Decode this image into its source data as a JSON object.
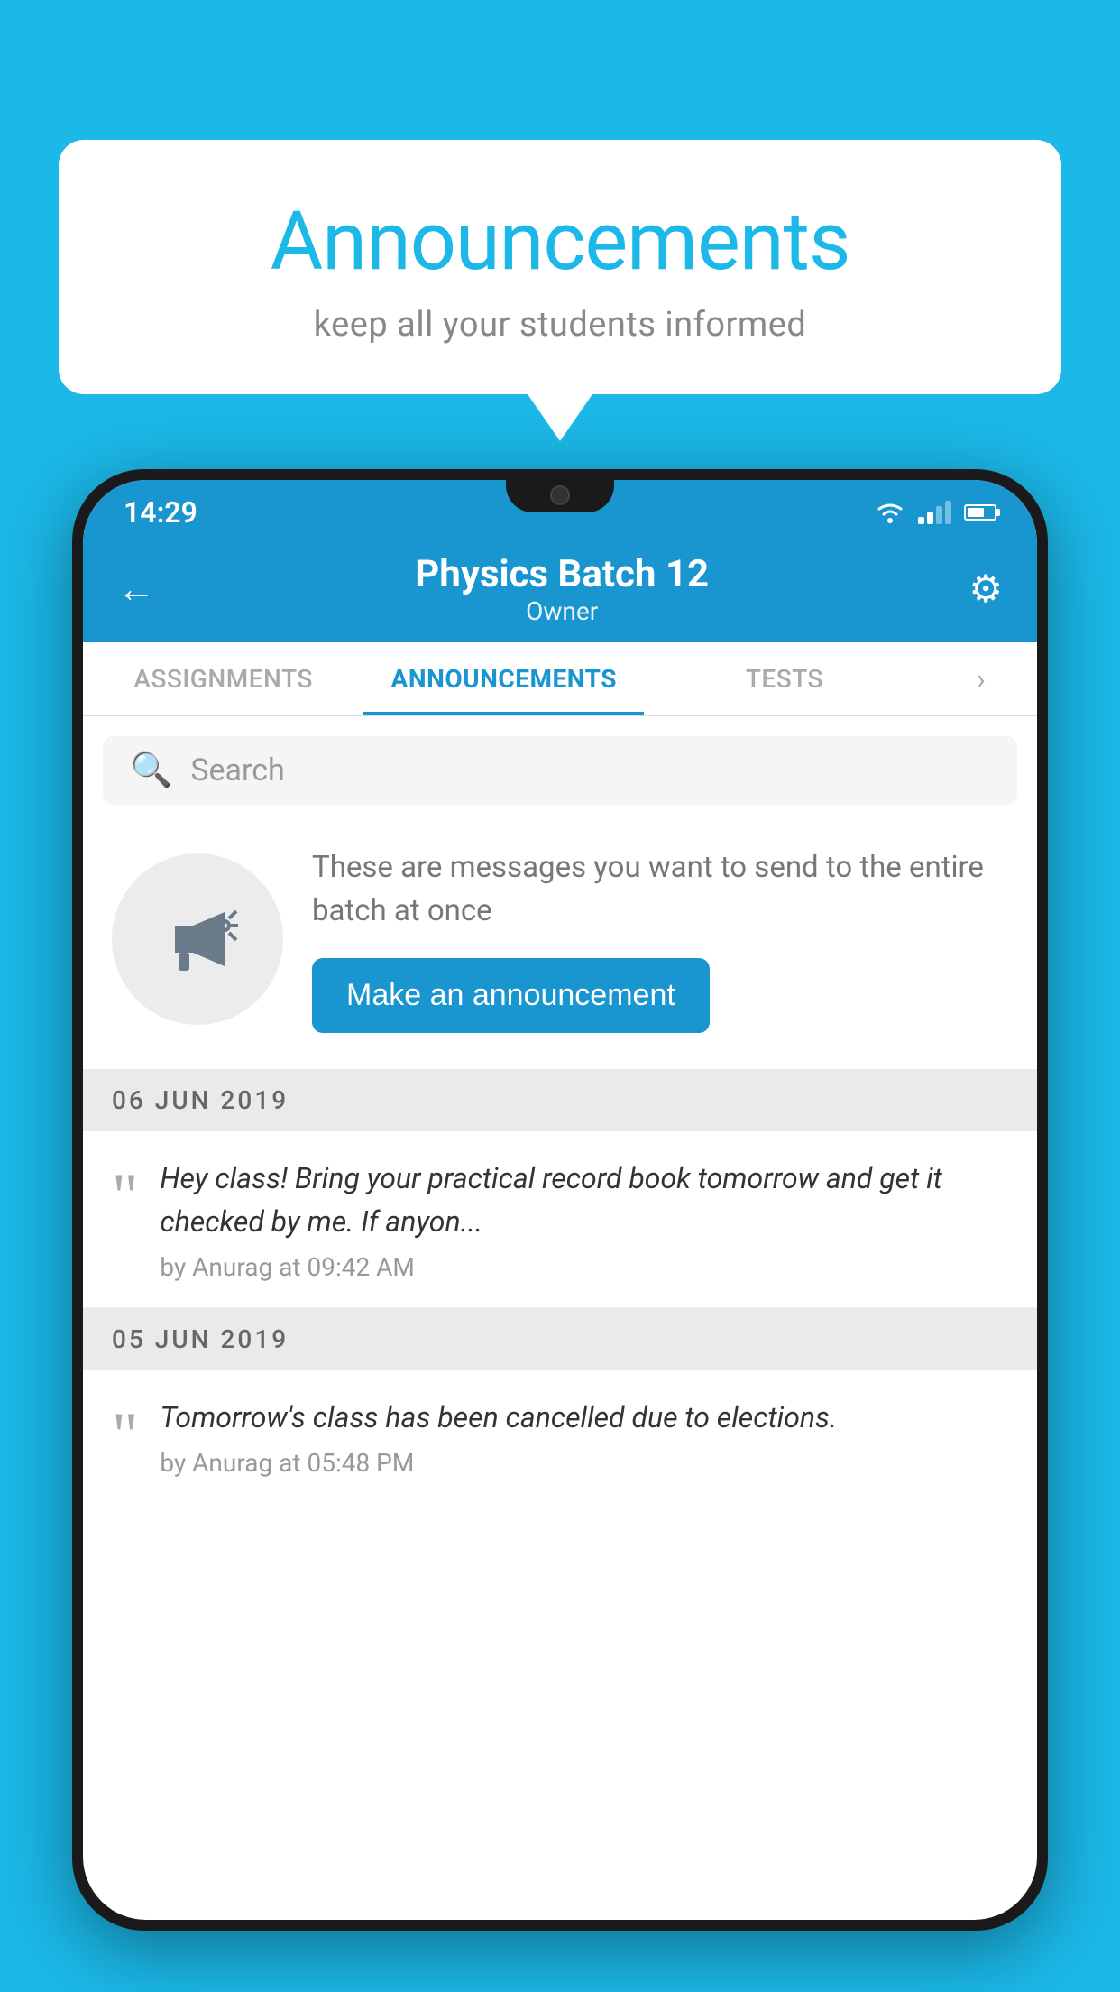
{
  "background_color": "#1BB8E8",
  "speech_bubble": {
    "title": "Announcements",
    "subtitle": "keep all your students informed"
  },
  "status_bar": {
    "time": "14:29",
    "wifi": "▼",
    "battery_level": 65
  },
  "app_header": {
    "back_label": "←",
    "batch_name": "Physics Batch 12",
    "owner_label": "Owner",
    "settings_label": "⚙"
  },
  "tabs": [
    {
      "label": "ASSIGNMENTS",
      "active": false
    },
    {
      "label": "ANNOUNCEMENTS",
      "active": true
    },
    {
      "label": "TESTS",
      "active": false
    }
  ],
  "search": {
    "placeholder": "Search"
  },
  "announcement_prompt": {
    "description": "These are messages you want to send to the entire batch at once",
    "button_label": "Make an announcement"
  },
  "announcements": [
    {
      "date": "06  JUN  2019",
      "text": "Hey class! Bring your practical record book tomorrow and get it checked by me. If anyon...",
      "meta": "by Anurag at 09:42 AM"
    },
    {
      "date": "05  JUN  2019",
      "text": "Tomorrow's class has been cancelled due to elections.",
      "meta": "by Anurag at 05:48 PM"
    }
  ]
}
